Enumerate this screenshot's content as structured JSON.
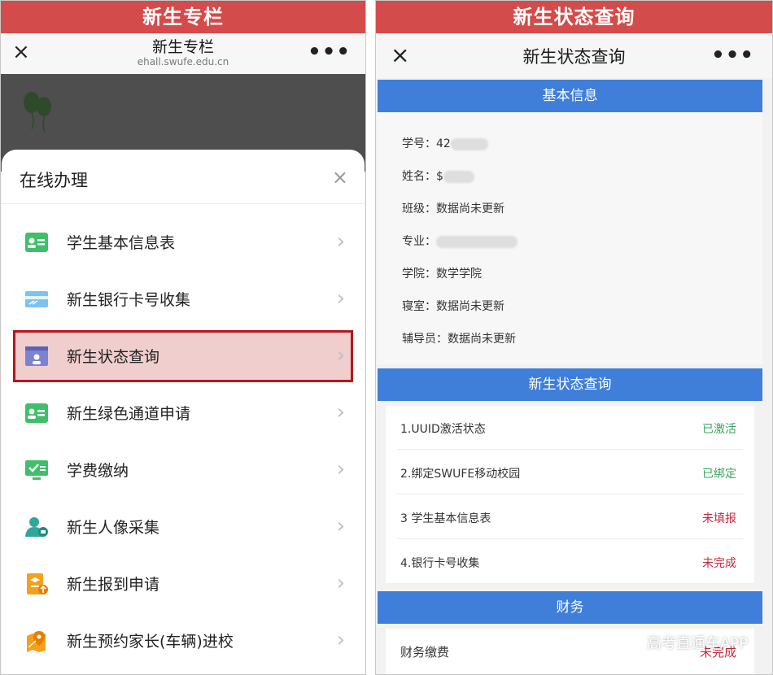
{
  "left": {
    "banner": "新生专栏",
    "nav": {
      "close": "×",
      "title": "新生专栏",
      "url": "ehall.swufe.edu.cn",
      "more": "•••"
    },
    "sheet": {
      "title": "在线办理",
      "close": "×",
      "items": [
        {
          "label": "学生基本信息表",
          "icon": "id-card-icon"
        },
        {
          "label": "新生银行卡号收集",
          "icon": "bank-card-icon"
        },
        {
          "label": "新生状态查询",
          "icon": "status-window-icon"
        },
        {
          "label": "新生绿色通道申请",
          "icon": "id-card-icon"
        },
        {
          "label": "学费缴纳",
          "icon": "monitor-check-icon"
        },
        {
          "label": "新生人像采集",
          "icon": "person-photo-icon"
        },
        {
          "label": "新生报到申请",
          "icon": "report-upload-icon"
        },
        {
          "label": "新生预约家长(车辆)进校",
          "icon": "map-pin-icon"
        }
      ],
      "chevron": "›"
    }
  },
  "right": {
    "banner": "新生状态查询",
    "nav": {
      "close": "×",
      "title": "新生状态查询",
      "more": "•••"
    },
    "basic_section": "基本信息",
    "basic_info": {
      "student_id_label": "学号：",
      "student_id_value": "42",
      "name_label": "姓名：",
      "name_value": "$",
      "class_label": "班级：",
      "class_value": "数据尚未更新",
      "major_label": "专业：",
      "major_value": "",
      "college_label": "学院：",
      "college_value": "数学学院",
      "dorm_label": "寝室：",
      "dorm_value": "数据尚未更新",
      "counselor_label": "辅导员：",
      "counselor_value": "数据尚未更新"
    },
    "status_section": "新生状态查询",
    "status_items": [
      {
        "label": "1.UUID激活状态",
        "value": "已激活"
      },
      {
        "label": "2.绑定SWUFE移动校园",
        "value": "已绑定"
      },
      {
        "label": "3 学生基本信息表",
        "value": "未填报"
      },
      {
        "label": "4.银行卡号收集",
        "value": "未完成"
      }
    ],
    "finance_section": "财务",
    "finance_item": {
      "label": "财务缴费",
      "value": "未完成"
    },
    "watermark": "高考直通车APP"
  },
  "colors": {
    "banner_red": "#d44b4b",
    "section_blue": "#3f7fda",
    "status_green": "#3aa55a",
    "status_red": "#c8283c",
    "highlight_border": "#b5161b",
    "highlight_fill": "#f0cece"
  }
}
